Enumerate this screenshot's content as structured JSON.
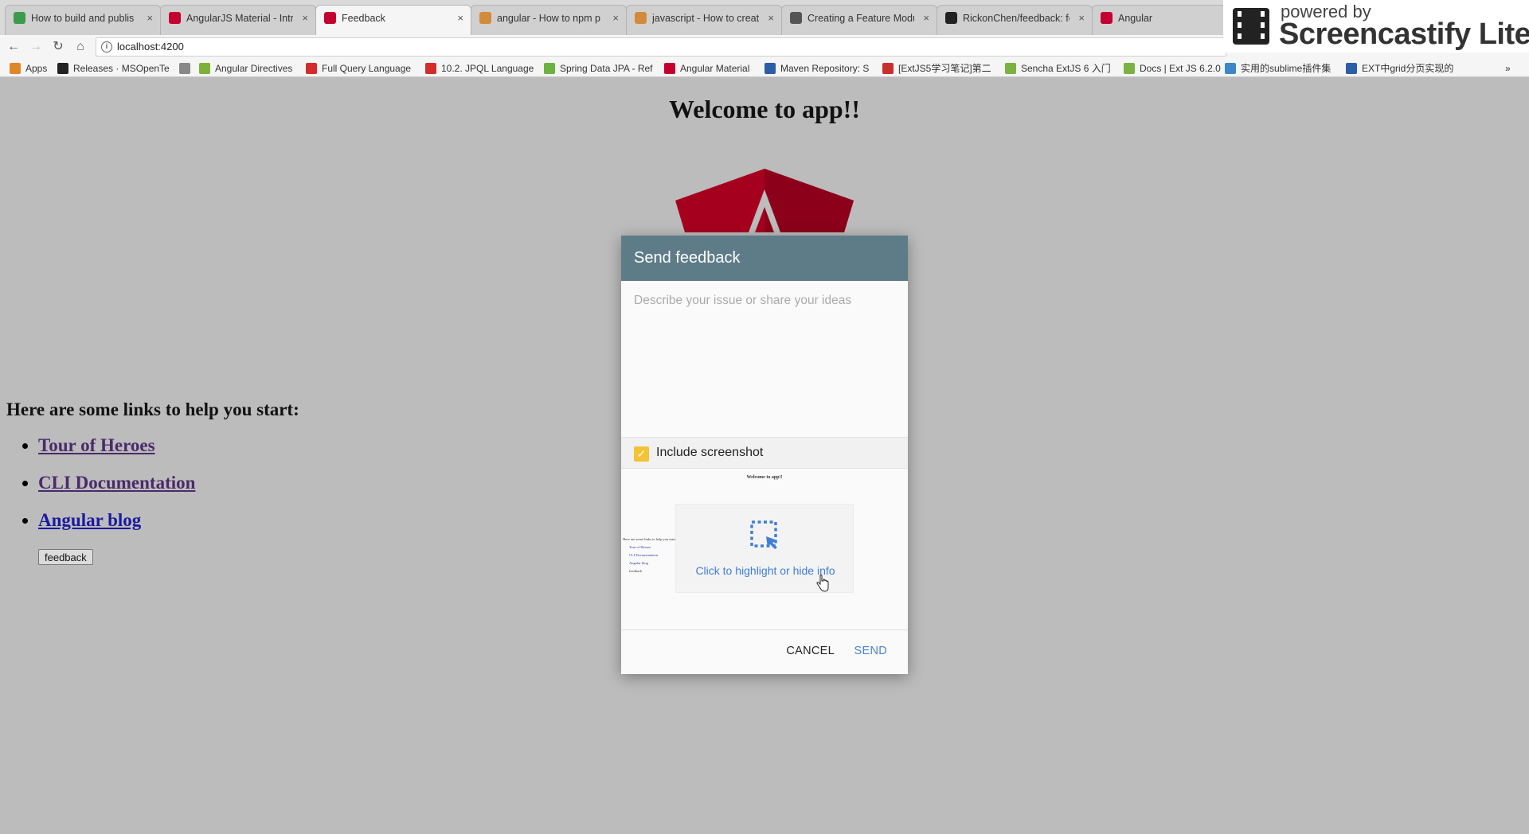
{
  "browser": {
    "tabs": [
      {
        "label": "How to build and publis",
        "icon": "m-logo-icon",
        "color": "#3a9b4c",
        "active": false
      },
      {
        "label": "AngularJS Material - Intr",
        "icon": "angular-icon",
        "color": "#c3002f",
        "active": false
      },
      {
        "label": "Feedback",
        "icon": "angular-icon",
        "color": "#c3002f",
        "active": true
      },
      {
        "label": "angular - How to npm p",
        "icon": "stackoverflow-icon",
        "color": "#d38a3a",
        "active": false
      },
      {
        "label": "javascript - How to creat",
        "icon": "stackoverflow-icon",
        "color": "#d38a3a",
        "active": false
      },
      {
        "label": "Creating a Feature Modu",
        "icon": "book-icon",
        "color": "#555555",
        "active": false
      },
      {
        "label": "RickonChen/feedback: fe",
        "icon": "github-icon",
        "color": "#222222",
        "active": false
      },
      {
        "label": "Angular",
        "icon": "angular-icon",
        "color": "#c3002f",
        "active": false
      }
    ],
    "url": "localhost:4200",
    "bookmarks": [
      {
        "label": "Apps",
        "icon": "apps-grid-icon",
        "color": "#e0872a"
      },
      {
        "label": "Releases · MSOpenTe",
        "icon": "github-icon",
        "color": "#222222"
      },
      {
        "label": "",
        "icon": "page-icon",
        "color": "#888888"
      },
      {
        "label": "Angular Directives",
        "icon": "angular-directives-icon",
        "color": "#7fb03a"
      },
      {
        "label": "Full Query Language",
        "icon": "oracle-icon",
        "color": "#d42b2b"
      },
      {
        "label": "10.2. JPQL Language",
        "icon": "oracle-icon",
        "color": "#d42b2b"
      },
      {
        "label": "Spring Data JPA - Ref",
        "icon": "spring-icon",
        "color": "#6db33f"
      },
      {
        "label": "Angular Material",
        "icon": "angular-icon",
        "color": "#c3002f"
      },
      {
        "label": "Maven Repository: S",
        "icon": "maven-icon",
        "color": "#2b5ea7"
      },
      {
        "label": "[ExtJS5学习笔记]第二",
        "icon": "csdn-icon",
        "color": "#c9302c"
      },
      {
        "label": "Sencha ExtJS 6 入门",
        "icon": "sencha-icon",
        "color": "#7ab342"
      },
      {
        "label": "Docs | Ext JS 6.2.0",
        "icon": "sencha-icon",
        "color": "#7ab342"
      },
      {
        "label": "实用的sublime插件集",
        "icon": "send-icon",
        "color": "#3a88c9"
      },
      {
        "label": "EXT中grid分页实现的",
        "icon": "cnblogs-icon",
        "color": "#2b5ea7"
      }
    ],
    "overflow": "»",
    "watermark": {
      "powered_by": "powered by",
      "name": "Screencastify Lite"
    }
  },
  "page": {
    "title": "Welcome to app!!",
    "links_heading": "Here are some links to help you start:",
    "links": [
      "Tour of Heroes",
      "CLI Documentation",
      "Angular blog"
    ],
    "feedback_button": "feedback"
  },
  "dialog": {
    "title": "Send feedback",
    "placeholder": "Describe your issue or share your ideas",
    "include_screenshot_label": "Include screenshot",
    "include_screenshot_checked": true,
    "highlight_text": "Click to highlight or hide info",
    "cancel": "CANCEL",
    "send": "SEND",
    "header_color": "#5e7c88",
    "accent_color": "#4b83d6",
    "checkbox_color": "#f4c335"
  }
}
